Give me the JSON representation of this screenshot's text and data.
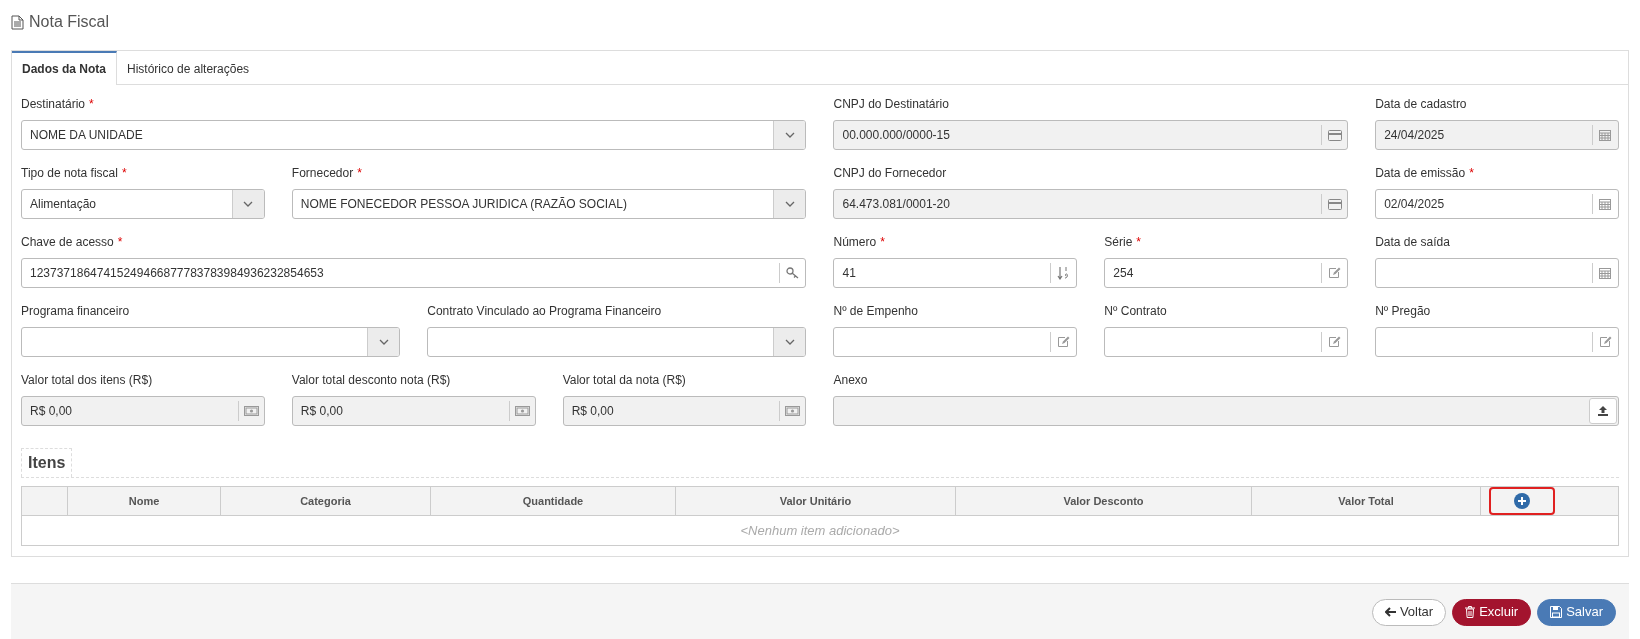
{
  "page_title": "Nota Fiscal",
  "required_marker": "*",
  "tabs": [
    {
      "label": "Dados da Nota",
      "selected": true
    },
    {
      "label": "Histórico de alterações",
      "selected": false
    }
  ],
  "fields": [
    {
      "label": "Destinatário",
      "required": true,
      "kind": "select",
      "value": "NOME DA UNIDADE",
      "disabled": false
    },
    {
      "label": "CNPJ do Destinatário",
      "required": false,
      "kind": "cnpj",
      "value": "00.000.000/0000-15",
      "disabled": true
    },
    {
      "label": "Data de cadastro",
      "required": false,
      "kind": "date",
      "value": "24/04/2025",
      "disabled": true
    },
    {
      "label": "Tipo de nota fiscal",
      "required": true,
      "kind": "select",
      "value": "Alimentação",
      "disabled": false
    },
    {
      "label": "Fornecedor",
      "required": true,
      "kind": "select",
      "value": "NOME FONECEDOR PESSOA JURIDICA (RAZÃO SOCIAL)",
      "disabled": false
    },
    {
      "label": "CNPJ do Fornecedor",
      "required": false,
      "kind": "cnpj",
      "value": "64.473.081/0001-20",
      "disabled": true
    },
    {
      "label": "Data de emissão",
      "required": true,
      "kind": "date",
      "value": "02/04/2025",
      "disabled": false
    },
    {
      "label": "Chave de acesso",
      "required": true,
      "kind": "key",
      "value": "12373718647415249466877783783984936232854653",
      "disabled": false
    },
    {
      "label": "Número",
      "required": true,
      "kind": "number",
      "value": "41",
      "disabled": false
    },
    {
      "label": "Série",
      "required": true,
      "kind": "text",
      "value": "254",
      "disabled": false
    },
    {
      "label": "Data de saída",
      "required": false,
      "kind": "date",
      "disabled": false
    },
    {
      "label": "Programa financeiro",
      "required": false,
      "kind": "select",
      "disabled": false
    },
    {
      "label": "Contrato Vinculado ao Programa Financeiro",
      "required": false,
      "kind": "select",
      "disabled": false
    },
    {
      "label": "Nº de Empenho",
      "required": false,
      "kind": "text",
      "disabled": false
    },
    {
      "label": "Nº Contrato",
      "required": false,
      "kind": "text",
      "disabled": false
    },
    {
      "label": "Nº Pregão",
      "required": false,
      "kind": "text",
      "disabled": false
    },
    {
      "label": "Valor total dos itens (R$)",
      "required": false,
      "kind": "currency",
      "value": "R$ 0,00",
      "disabled": true
    },
    {
      "label": "Valor total desconto nota (R$)",
      "required": false,
      "kind": "currency",
      "value": "R$ 0,00",
      "disabled": true
    },
    {
      "label": "Valor total da nota (R$)",
      "required": false,
      "kind": "currency",
      "value": "R$ 0,00",
      "disabled": true
    },
    {
      "label": "Anexo",
      "required": false,
      "kind": "file",
      "disabled": true
    }
  ],
  "items": {
    "title": "Itens",
    "columns": [
      "Nome",
      "Categoria",
      "Quantidade",
      "Valor Unitário",
      "Valor Desconto",
      "Valor Total"
    ],
    "empty_message": "<Nenhum item adicionado>",
    "add_button": {
      "highlighted": true
    }
  },
  "buttons": [
    {
      "label": "Voltar",
      "kind": "back"
    },
    {
      "label": "Excluir",
      "kind": "delete"
    },
    {
      "label": "Salvar",
      "kind": "save"
    }
  ]
}
